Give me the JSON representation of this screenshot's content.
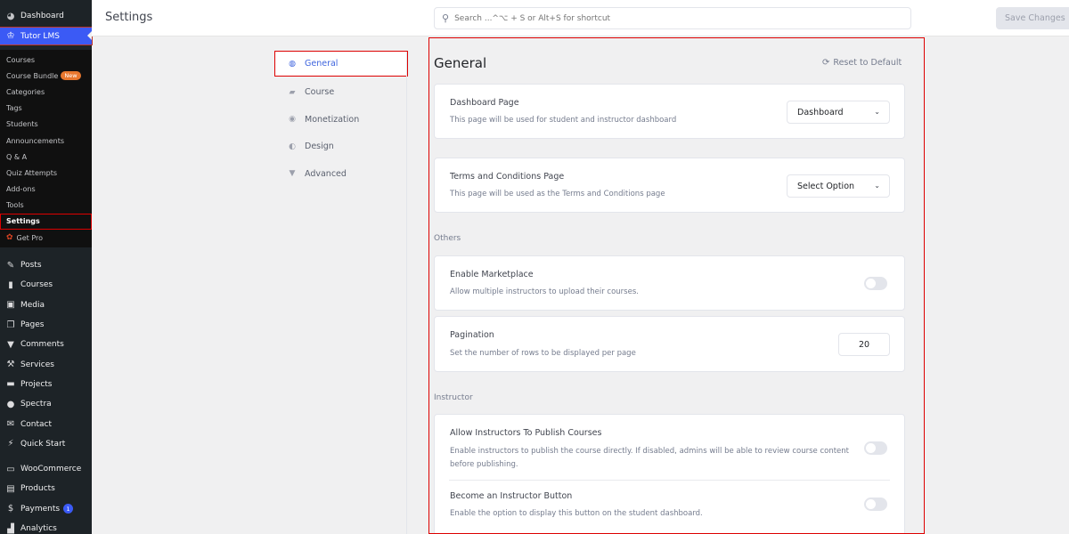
{
  "sidebar": {
    "dashboard": {
      "label": "Dashboard",
      "icon": "dashboard-icon"
    },
    "tutor": {
      "label": "Tutor LMS",
      "icon": "tutor-icon"
    },
    "submenu": [
      {
        "label": "Courses"
      },
      {
        "label": "Course Bundle",
        "badge": "New"
      },
      {
        "label": "Categories"
      },
      {
        "label": "Tags"
      },
      {
        "label": "Students"
      },
      {
        "label": "Announcements"
      },
      {
        "label": "Q & A"
      },
      {
        "label": "Quiz Attempts"
      },
      {
        "label": "Add-ons"
      },
      {
        "label": "Tools"
      },
      {
        "label": "Settings",
        "active": true
      },
      {
        "label": "Get Pro"
      }
    ],
    "main": [
      {
        "label": "Posts",
        "icon": "pin-icon"
      },
      {
        "label": "Courses",
        "icon": "book-icon"
      },
      {
        "label": "Media",
        "icon": "media-icon"
      },
      {
        "label": "Pages",
        "icon": "pages-icon"
      },
      {
        "label": "Comments",
        "icon": "comment-icon"
      },
      {
        "label": "Services",
        "icon": "wrench-icon"
      },
      {
        "label": "Projects",
        "icon": "folder-icon"
      },
      {
        "label": "Spectra",
        "icon": "spectra-icon"
      },
      {
        "label": "Contact",
        "icon": "mail-icon"
      },
      {
        "label": "Quick Start",
        "icon": "plug-icon"
      },
      {
        "label": "WooCommerce",
        "icon": "woo-icon"
      },
      {
        "label": "Products",
        "icon": "archive-icon"
      },
      {
        "label": "Payments",
        "icon": "dollar-icon",
        "badge": "1"
      },
      {
        "label": "Analytics",
        "icon": "chart-icon"
      }
    ]
  },
  "header": {
    "title": "Settings",
    "search_placeholder": "Search ...^⌥ + S or Alt+S for shortcut",
    "save_label": "Save Changes"
  },
  "settings_nav": [
    {
      "label": "General",
      "active": true
    },
    {
      "label": "Course"
    },
    {
      "label": "Monetization"
    },
    {
      "label": "Design"
    },
    {
      "label": "Advanced"
    }
  ],
  "content": {
    "title": "General",
    "reset_label": "Reset to Default",
    "dashboard_page": {
      "title": "Dashboard Page",
      "desc": "This page will be used for student and instructor dashboard",
      "value": "Dashboard"
    },
    "terms_page": {
      "title": "Terms and Conditions Page",
      "desc": "This page will be used as the Terms and Conditions page",
      "value": "Select Option"
    },
    "others_label": "Others",
    "marketplace": {
      "title": "Enable Marketplace",
      "desc": "Allow multiple instructors to upload their courses.",
      "enabled": false
    },
    "pagination": {
      "title": "Pagination",
      "desc": "Set the number of rows to be displayed per page",
      "value": "20"
    },
    "instructor_label": "Instructor",
    "publish_courses": {
      "title": "Allow Instructors To Publish Courses",
      "desc": "Enable instructors to publish the course directly. If disabled, admins will be able to review course content before publishing.",
      "enabled": false
    },
    "become_instructor": {
      "title": "Become an Instructor Button",
      "desc": "Enable the option to display this button on the student dashboard.",
      "enabled": false
    }
  },
  "colors": {
    "accent": "#3e64de",
    "sidebar_bg": "#1d2327",
    "highlight_border": "#dd0000"
  }
}
